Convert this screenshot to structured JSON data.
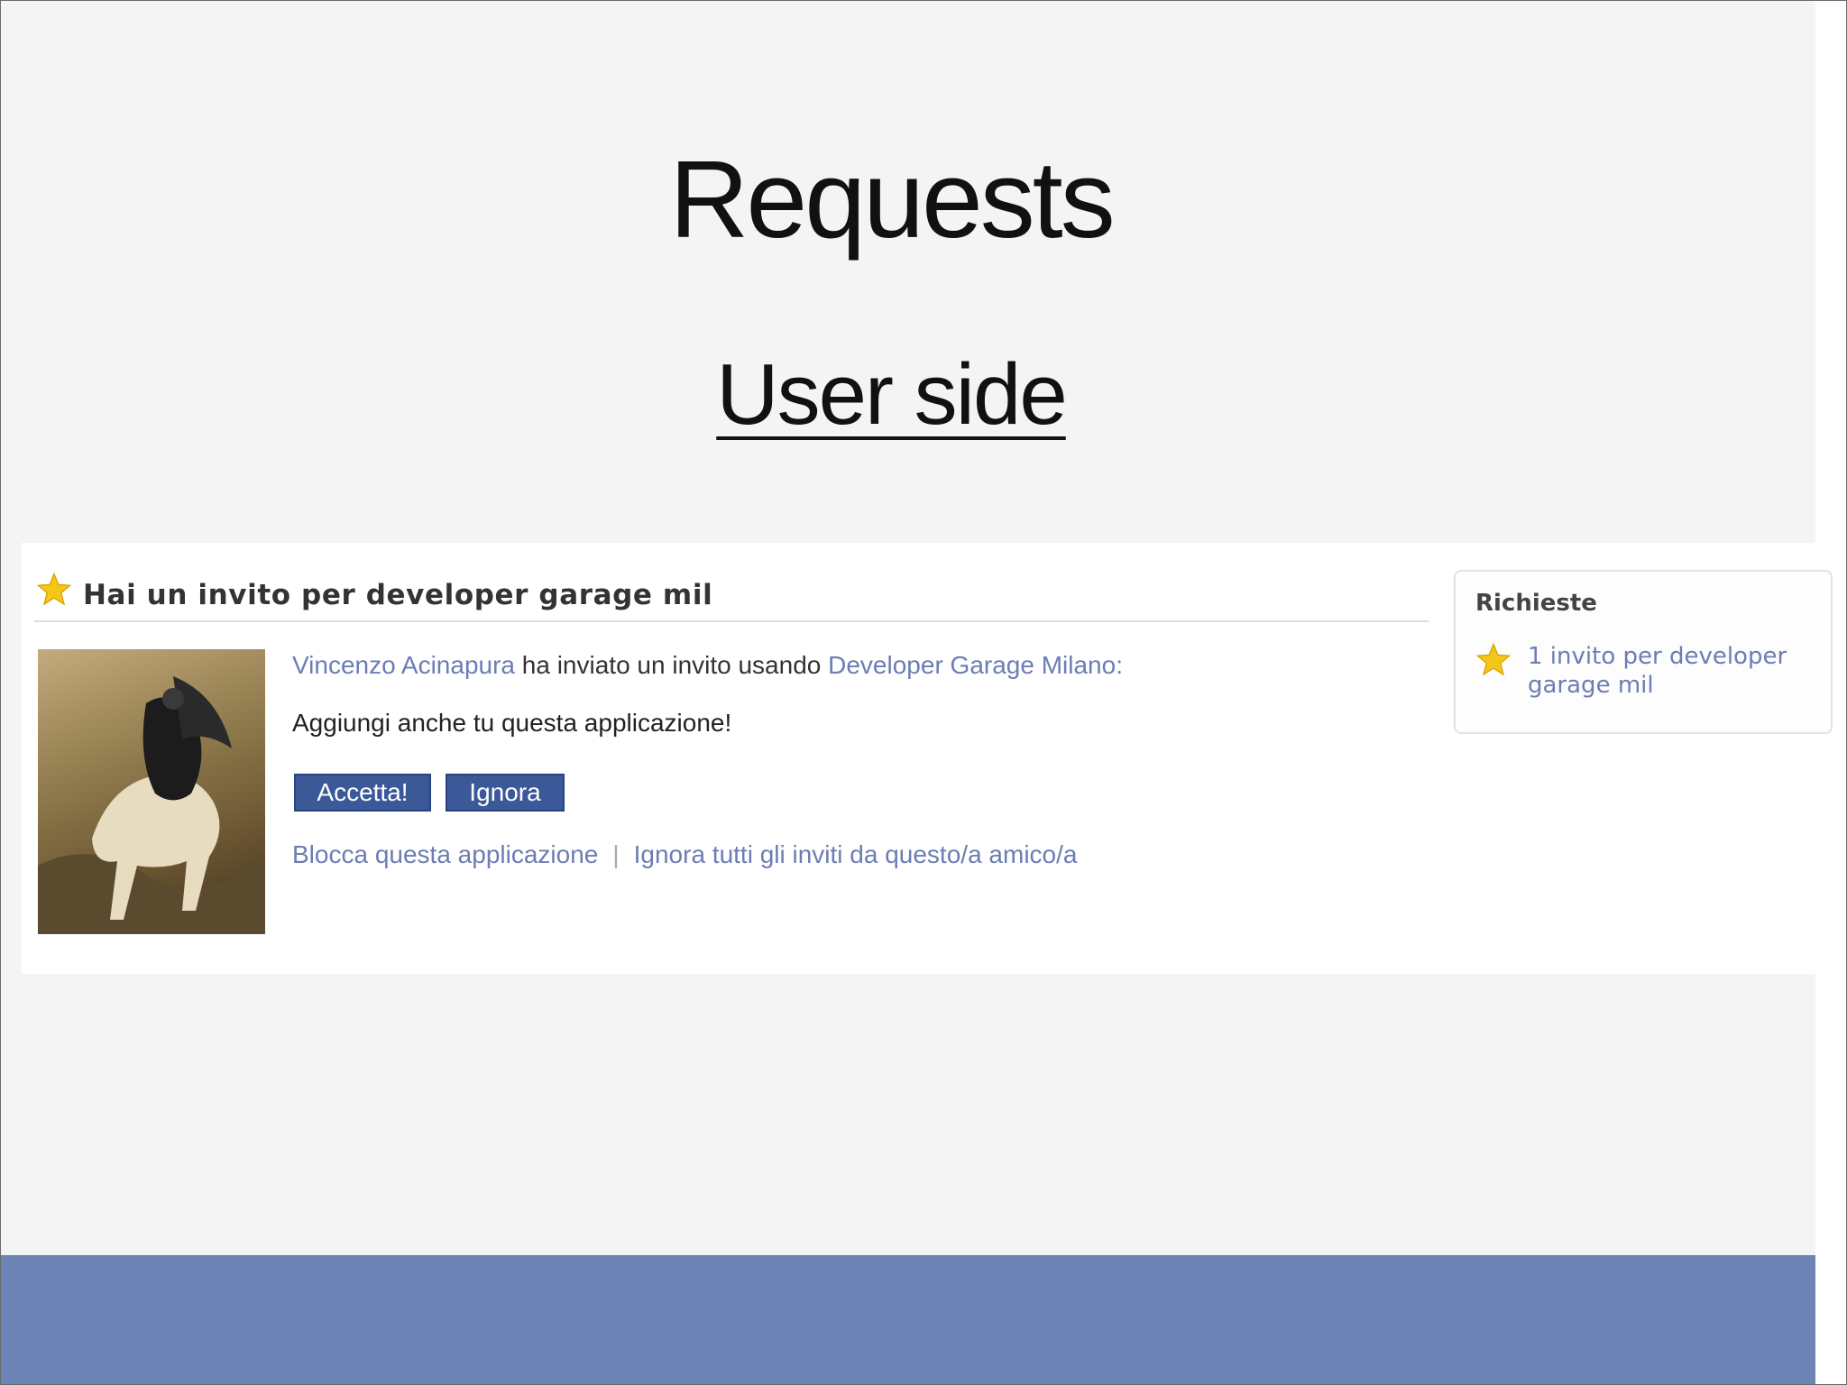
{
  "slide": {
    "title": "Requests",
    "subtitle": "User side"
  },
  "request": {
    "heading": "Hai un invito per developer garage mil",
    "sender": "Vincenzo Acinapura",
    "sent_text": " ha inviato un invito usando ",
    "app_name": "Developer Garage Milano:",
    "message": "Aggiungi anche tu questa applicazione!",
    "accept_label": "Accetta!",
    "ignore_label": "Ignora",
    "block_app_label": "Blocca questa applicazione",
    "separator": "|",
    "ignore_all_label": "Ignora tutti gli inviti da questo/a amico/a"
  },
  "sidebar": {
    "title": "Richieste",
    "link": "1 invito per developer garage mil"
  },
  "colors": {
    "link": "#6b7db4",
    "button": "#3b5998",
    "footer_band": "#6b83b5",
    "star": "#f5c518"
  },
  "icons": [
    "star-icon"
  ]
}
